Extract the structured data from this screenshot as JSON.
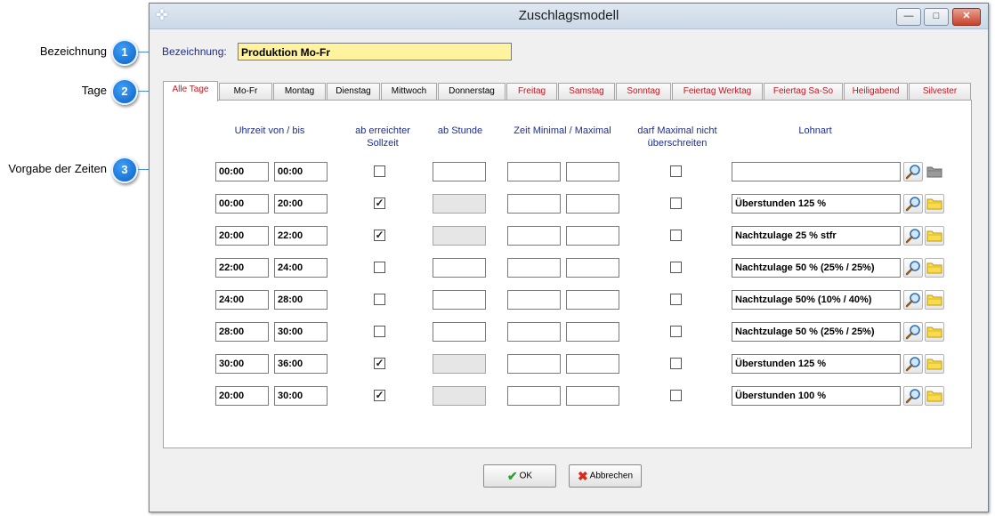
{
  "callouts": [
    {
      "num": "1",
      "label": "Bezeichnung"
    },
    {
      "num": "2",
      "label": "Tage"
    },
    {
      "num": "3",
      "label": "Vorgabe der Zeiten"
    }
  ],
  "window": {
    "title": "Zuschlagsmodell"
  },
  "bezeichnung": {
    "label": "Bezeichnung:",
    "value": "Produktion Mo-Fr"
  },
  "tabs": [
    {
      "label": "Alle Tage",
      "active": true
    },
    {
      "label": "Mo-Fr"
    },
    {
      "label": "Montag"
    },
    {
      "label": "Dienstag"
    },
    {
      "label": "Mittwoch"
    },
    {
      "label": "Donnerstag"
    },
    {
      "label": "Freitag",
      "weekend": true
    },
    {
      "label": "Samstag",
      "weekend": true
    },
    {
      "label": "Sonntag",
      "weekend": true
    },
    {
      "label": "Feiertag Werktag",
      "weekend": true
    },
    {
      "label": "Feiertag Sa-So",
      "weekend": true
    },
    {
      "label": "Heiligabend",
      "weekend": true
    },
    {
      "label": "Silvester",
      "weekend": true
    }
  ],
  "columns": {
    "uhrzeit": "Uhrzeit von / bis",
    "sollzeit": "ab erreichter\nSollzeit",
    "stunde": "ab Stunde",
    "minmax": "Zeit Minimal / Maximal",
    "nicht_ueber": "darf Maximal nicht\nüberschreiten",
    "lohnart": "Lohnart"
  },
  "rows": [
    {
      "von": "00:00",
      "bis": "00:00",
      "sollzeit": false,
      "lohnart": ""
    },
    {
      "von": "00:00",
      "bis": "20:00",
      "sollzeit": true,
      "lohnart": "Überstunden 125 %"
    },
    {
      "von": "20:00",
      "bis": "22:00",
      "sollzeit": true,
      "lohnart": "Nachtzulage 25 % stfr"
    },
    {
      "von": "22:00",
      "bis": "24:00",
      "sollzeit": false,
      "lohnart": "Nachtzulage 50 % (25% / 25%)"
    },
    {
      "von": "24:00",
      "bis": "28:00",
      "sollzeit": false,
      "lohnart": "Nachtzulage 50%  (10% / 40%)"
    },
    {
      "von": "28:00",
      "bis": "30:00",
      "sollzeit": false,
      "lohnart": "Nachtzulage 50 % (25% / 25%)"
    },
    {
      "von": "30:00",
      "bis": "36:00",
      "sollzeit": true,
      "lohnart": "Überstunden 125 %"
    },
    {
      "von": "20:00",
      "bis": "30:00",
      "sollzeit": true,
      "lohnart": "Überstunden 100 %"
    }
  ],
  "buttons": {
    "ok": "OK",
    "cancel": "Abbrechen"
  },
  "icons": {
    "search": "magnifier-icon",
    "folder": "folder-icon"
  },
  "colors": {
    "label_blue": "#1d2d8f",
    "weekend_red": "#c8141e",
    "name_field": "#fff3a0"
  }
}
